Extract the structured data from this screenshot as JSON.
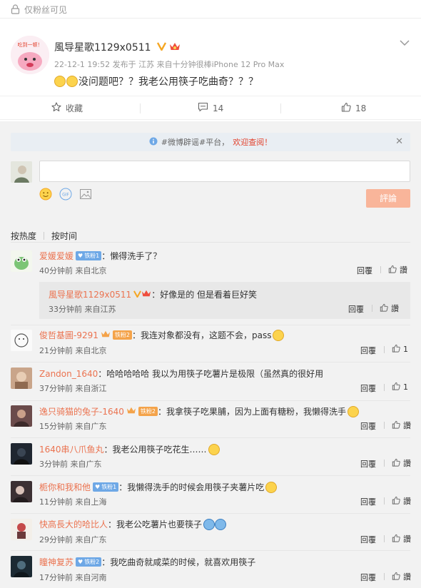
{
  "visibility": {
    "label": "仅粉丝可见"
  },
  "post": {
    "author": "風导星歌1129x0511",
    "meta": "22-12-1 19:52 发布于 江苏  来自十分钟很棒iPhone 12 Pro Max",
    "text": "没问题吧？？我老公用筷子吃曲奇？？？",
    "avatar_text": "吃到一顿！"
  },
  "actions": {
    "favorite": "收藏",
    "comments": "14",
    "likes": "18"
  },
  "notice": {
    "text": "#微博辟谣#平台，",
    "highlight": "欢迎查阅！"
  },
  "composer": {
    "submit": "評論"
  },
  "sort": {
    "hot": "按热度",
    "time": "按时间"
  },
  "labels": {
    "reply": "回覆",
    "like": "讚"
  },
  "comments": [
    {
      "name": "爱媛爱媛",
      "badge": "铁粉1",
      "text": "：懒得洗手了？",
      "time": "40分钟前  来自北京",
      "likes": ""
    },
    {
      "name": "風导星歌1129x0511",
      "text": "：好像是的 但是看着巨好笑",
      "time": "33分钟前  来自江苏",
      "likes": ""
    },
    {
      "name": "俊哲基圖-9291",
      "badge": "铁粉2",
      "text": "：我连对象都没有，这题不会，pass",
      "time": "21分钟前  来自北京",
      "likes": "1"
    },
    {
      "name": "Zandon_1640",
      "text": "：哈哈哈哈哈 我以为用筷子吃薯片是极限（虽然真的很好用",
      "time": "37分钟前  来自浙江",
      "likes": "1"
    },
    {
      "name": "逸只骑猫的兔子-1640",
      "badge": "铁粉2",
      "text": "：我拿筷子吃果脯，因为上面有糖粉，我懒得洗手",
      "time": "15分钟前  来自广东",
      "likes": ""
    },
    {
      "name": "1640串八爪鱼丸",
      "text": "：我老公用筷子吃花生……",
      "time": "3分钟前  来自广东",
      "likes": ""
    },
    {
      "name": "栀你和我和他",
      "badge": "铁粉1",
      "text": "：我懒得洗手的时候会用筷子夹薯片吃",
      "time": "11分钟前  来自上海",
      "likes": ""
    },
    {
      "name": "快高長大的哈比人",
      "text": "：我老公吃薯片也要筷子",
      "time": "29分钟前  来自广东",
      "likes": ""
    },
    {
      "name": "瞳神复苏",
      "badge": "铁粉2",
      "text": "：我吃曲奇就咸菜的时候，就喜欢用筷子",
      "time": "17分钟前  来自河南",
      "likes": ""
    }
  ]
}
